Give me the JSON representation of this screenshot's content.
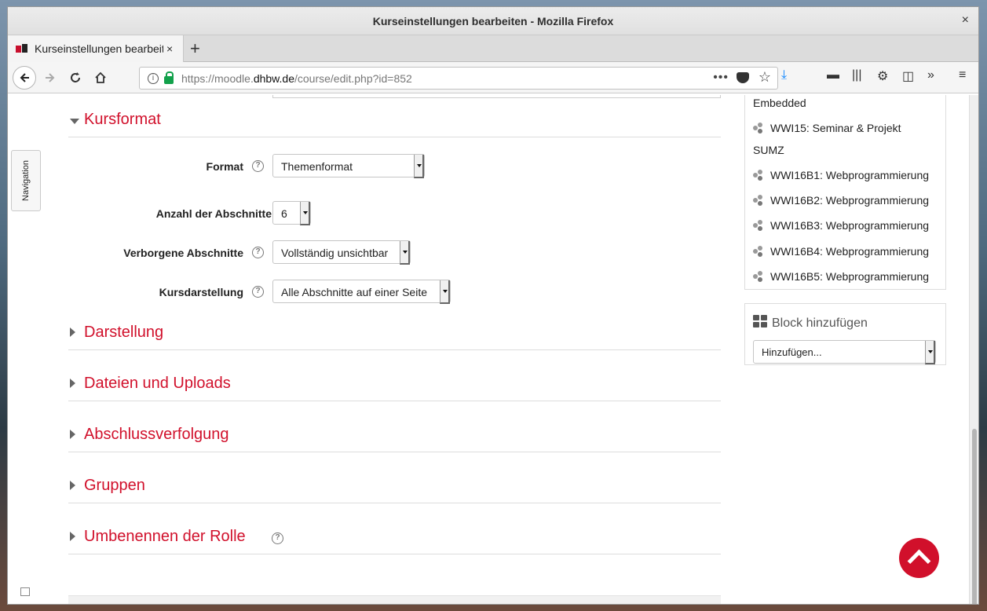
{
  "window": {
    "title": "Kurseinstellungen bearbeiten - Mozilla Firefox",
    "close": "×"
  },
  "tab": {
    "label": "Kurseinstellungen bearbeiten",
    "close": "×",
    "new": "+"
  },
  "urlbar": {
    "prefix": "https://moodle.",
    "domain": "dhbw.de",
    "path": "/course/edit.php?id=852",
    "dots": "•••"
  },
  "nav_drawer": {
    "label": "Navigation"
  },
  "sections": {
    "kursformat": "Kursformat",
    "darstellung": "Darstellung",
    "dateien": "Dateien und Uploads",
    "abschluss": "Abschlussverfolgung",
    "gruppen": "Gruppen",
    "rolle": "Umbenennen der Rolle"
  },
  "form": {
    "format": {
      "label": "Format",
      "value": "Themenformat"
    },
    "abschnitte": {
      "label": "Anzahl der Abschnitte",
      "value": "6"
    },
    "verborgen": {
      "label": "Verborgene Abschnitte",
      "value": "Vollständig unsichtbar"
    },
    "darstellung": {
      "label": "Kursdarstellung",
      "value": "Alle Abschnitte auf einer Seite"
    }
  },
  "help_glyph": "?",
  "courses_block": {
    "items": [
      "Embedded",
      "WWI15: Seminar & Projekt",
      "SUMZ",
      "WWI16B1: Webprogrammierung",
      "WWI16B2: Webprogrammierung",
      "WWI16B3: Webprogrammierung",
      "WWI16B4: Webprogrammierung",
      "WWI16B5: Webprogrammierung"
    ]
  },
  "add_block": {
    "title": "Block hinzufügen",
    "select": "Hinzufügen..."
  },
  "colors": {
    "accent": "#d1102b",
    "heading_red": "#d1102b"
  }
}
